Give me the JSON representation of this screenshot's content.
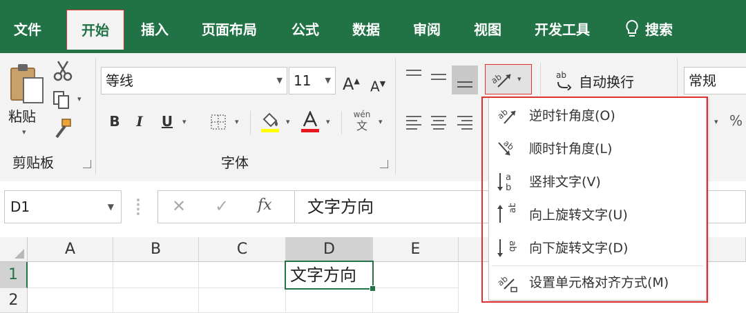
{
  "tabs": [
    {
      "label": "文件"
    },
    {
      "label": "开始"
    },
    {
      "label": "插入"
    },
    {
      "label": "页面布局"
    },
    {
      "label": "公式"
    },
    {
      "label": "数据"
    },
    {
      "label": "审阅"
    },
    {
      "label": "视图"
    },
    {
      "label": "开发工具"
    },
    {
      "label": "搜索"
    }
  ],
  "ribbon": {
    "clipboard": {
      "paste_label": "粘贴",
      "group_label": "剪贴板"
    },
    "font": {
      "font_name": "等线",
      "font_size": "11",
      "bold": "B",
      "italic": "I",
      "underline": "U",
      "group_label": "字体",
      "phonetic_top": "wén",
      "phonetic_bottom": "文",
      "grow": "A",
      "shrink": "A",
      "fill_color": "#ffff00",
      "font_color": "#e8161d"
    },
    "alignment": {
      "wrap_text_label": "自动换行"
    },
    "number": {
      "format": "常规"
    }
  },
  "formula_bar": {
    "name_box": "D1",
    "cancel": "✕",
    "enter": "✓",
    "fx": "fx",
    "content": "文字方向"
  },
  "sheet": {
    "columns": [
      "A",
      "B",
      "C",
      "D",
      "E"
    ],
    "rows": [
      "1",
      "2"
    ],
    "active_cell_text": "文字方向"
  },
  "orientation_menu": {
    "items": [
      {
        "label": "逆时针角度(O)",
        "icon": "angle-counterclockwise-icon"
      },
      {
        "label": "顺时针角度(L)",
        "icon": "angle-clockwise-icon"
      },
      {
        "label": "竖排文字(V)",
        "icon": "vertical-text-icon"
      },
      {
        "label": "向上旋转文字(U)",
        "icon": "rotate-text-up-icon"
      },
      {
        "label": "向下旋转文字(D)",
        "icon": "rotate-text-down-icon"
      },
      {
        "label": "设置单元格对齐方式(M)",
        "icon": "format-cell-alignment-icon"
      }
    ]
  }
}
